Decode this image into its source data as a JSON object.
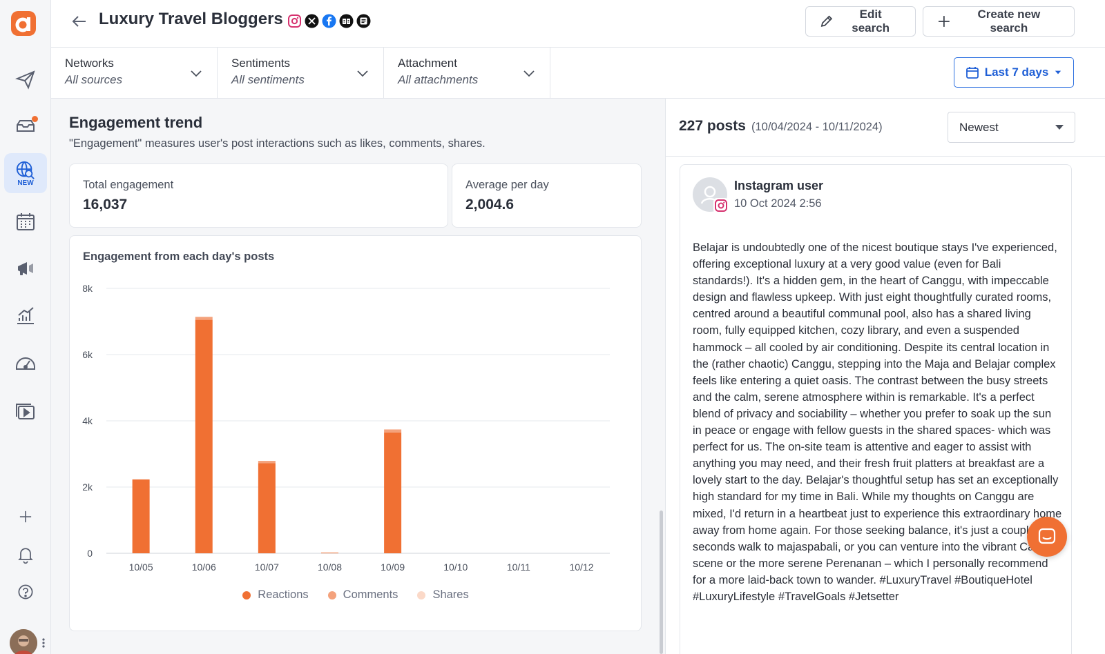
{
  "header": {
    "title": "Luxury Travel Bloggers",
    "networks": [
      "instagram-icon",
      "x-icon",
      "facebook-icon",
      "reviews-icon",
      "news-icon"
    ],
    "edit_label": "Edit search",
    "create_label": "Create new search"
  },
  "rail": {
    "new_badge": "NEW",
    "items": [
      "publish-icon",
      "inbox-icon",
      "listening-icon",
      "calendar-icon",
      "campaigns-icon",
      "analytics-icon",
      "dashboard-icon",
      "media-icon"
    ],
    "bottom": [
      "add-icon",
      "bell-icon",
      "help-icon"
    ]
  },
  "filters": [
    {
      "label": "Networks",
      "value": "All sources"
    },
    {
      "label": "Sentiments",
      "value": "All sentiments"
    },
    {
      "label": "Attachment",
      "value": "All attachments"
    }
  ],
  "date_filter": "Last 7 days",
  "engagement": {
    "title": "Engagement trend",
    "description": "\"Engagement\" measures user's post interactions such as likes, comments, shares.",
    "total_label": "Total engagement",
    "total_value": "16,037",
    "avg_label": "Average per day",
    "avg_value": "2,004.6",
    "chart_title": "Engagement from each day's posts"
  },
  "chart_data": {
    "type": "bar",
    "stacked": true,
    "categories": [
      "10/05",
      "10/06",
      "10/07",
      "10/08",
      "10/09",
      "10/10",
      "10/11",
      "10/12"
    ],
    "series": [
      {
        "name": "Reactions",
        "color": "#f07033",
        "values": [
          2230,
          7050,
          2720,
          20,
          3650,
          0,
          0,
          0
        ]
      },
      {
        "name": "Comments",
        "color": "#f4a27c",
        "values": [
          0,
          90,
          70,
          0,
          90,
          0,
          0,
          0
        ]
      },
      {
        "name": "Shares",
        "color": "#fbd9c8",
        "values": [
          0,
          0,
          0,
          0,
          0,
          0,
          0,
          0
        ]
      }
    ],
    "yticks": [
      "0",
      "2k",
      "4k",
      "6k",
      "8k"
    ],
    "ylim": [
      0,
      8000
    ],
    "grid": true,
    "legend": "bottom"
  },
  "posts": {
    "count": "227 posts",
    "range": "(10/04/2024 - 10/11/2024)",
    "sort": "Newest",
    "items": [
      {
        "user": "Instagram user",
        "network": "instagram-icon",
        "date": "10 Oct 2024 2:56",
        "body": "Belajar is undoubtedly one of the nicest boutique stays I've experienced, offering exceptional luxury at a very good value (even for Bali standards!). It's a hidden gem, in the heart of Canggu, with impeccable design and flawless upkeep. With just eight thoughtfully curated rooms, centred around a beautiful communal pool, also has a shared living room, fully equipped kitchen, cozy library, and even a suspended hammock – all cooled by air conditioning. Despite its central location in the (rather chaotic) Canggu, stepping into the Maja and Belajar complex feels like entering a quiet oasis. The contrast between the busy streets and the calm, serene atmosphere within is remarkable. It's a perfect blend of privacy and sociability – whether you prefer to soak up the sun in peace or engage with fellow guests in the shared spaces- which was perfect for us. The on-site team is attentive and eager to assist with anything you may need, and their fresh fruit platters at breakfast are a lovely start to the day. Belajar's thoughtful setup has set an exceptionally high standard for my time in Bali. While my thoughts on Canggu are mixed, I'd return in a heartbeat just to experience this extraordinary home away from home again. For those seeking balance, it's just a couple of seconds walk to majaspabali, or you can venture into the vibrant Canggu scene or the more serene Perenanan – which I personally recommend for a more laid-back town to wander. #LuxuryTravel #BoutiqueHotel #LuxuryLifestyle #TravelGoals #Jetsetter"
      }
    ]
  }
}
